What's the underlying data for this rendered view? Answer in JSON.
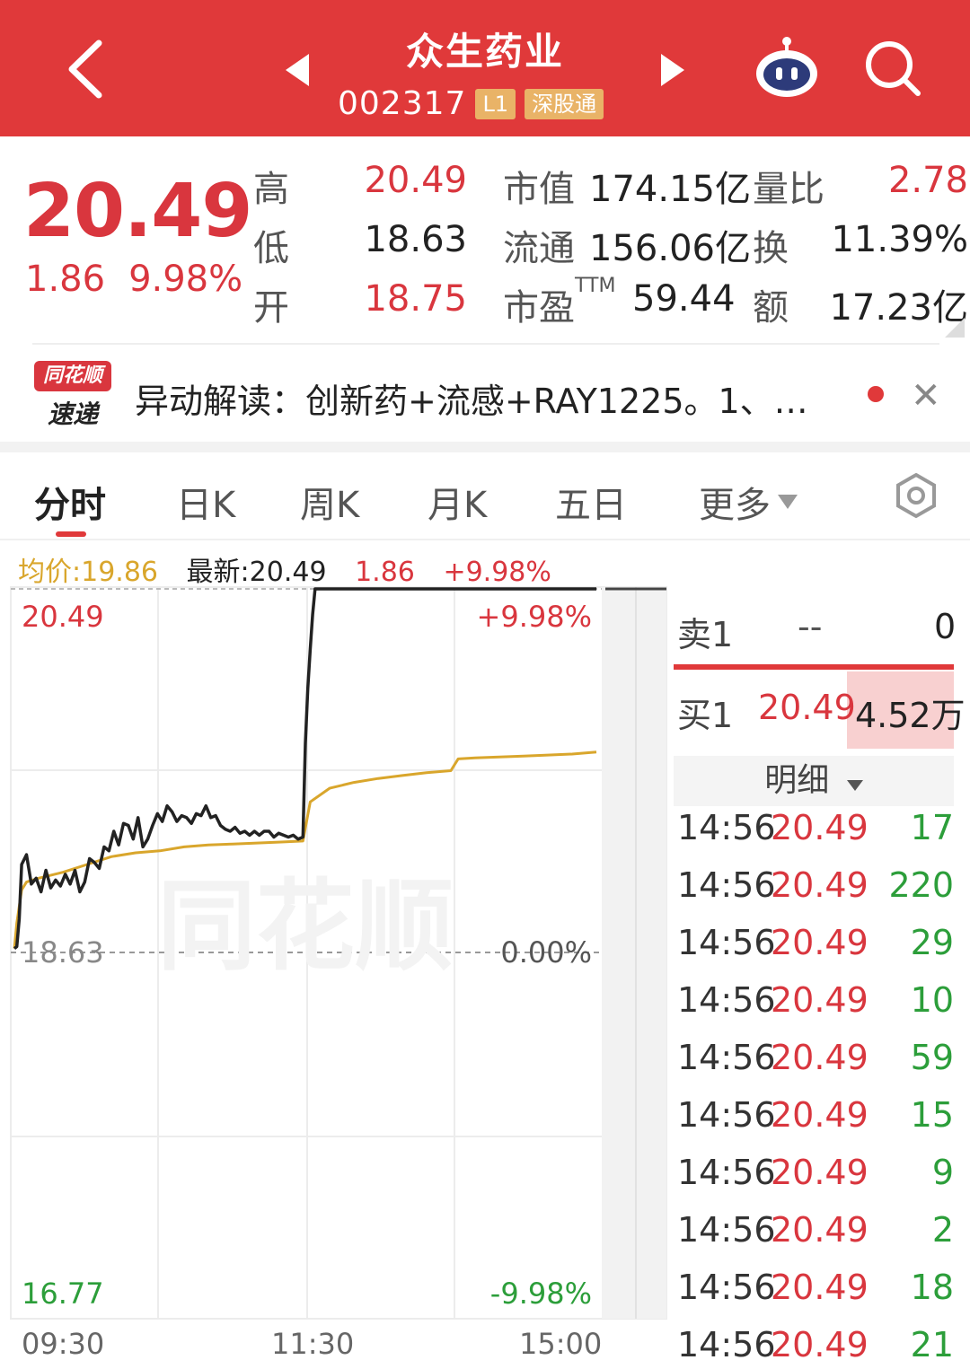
{
  "header": {
    "title": "众生药业",
    "code": "002317",
    "badge_level": "L1",
    "badge_connect": "深股通"
  },
  "quote": {
    "price": "20.49",
    "change": "1.86",
    "change_pct": "9.98%",
    "high_label": "高",
    "high": "20.49",
    "low_label": "低",
    "low": "18.63",
    "open_label": "开",
    "open": "18.75",
    "mcap_label": "市值",
    "mcap": "174.15亿",
    "float_label": "流通",
    "float": "156.06亿",
    "pe_label": "市盈",
    "pe_sup": "TTM",
    "pe": "59.44",
    "vol_ratio_label": "量比",
    "vol_ratio": "2.78",
    "turnover_label": "换",
    "turnover": "11.39%",
    "amount_label": "额",
    "amount": "17.23亿"
  },
  "news": {
    "logo_top": "同花顺",
    "logo_bottom": "速递",
    "text": "异动解读：创新药+流感+RAY1225。1、…"
  },
  "tabs": [
    {
      "label": "分时"
    },
    {
      "label": "日K"
    },
    {
      "label": "周K"
    },
    {
      "label": "月K"
    },
    {
      "label": "五日"
    },
    {
      "label": "更多"
    }
  ],
  "legend": {
    "avg": "均价:19.86",
    "latest": "最新:20.49",
    "chg": "1.86",
    "chg_pct": "+9.98%"
  },
  "chart_labels": {
    "top_price": "20.49",
    "top_pct": "+9.98%",
    "mid_price": "18.63",
    "mid_pct": "0.00%",
    "bottom_price": "16.77",
    "bottom_pct": "-9.98%",
    "watermark": "同花顺",
    "time_start": "09:30",
    "time_mid": "11:30",
    "time_end": "15:00"
  },
  "chart_data": {
    "type": "line",
    "ylim": [
      16.77,
      20.49
    ],
    "prev_close": 18.63,
    "x_labels": [
      "09:30",
      "11:30",
      "15:00"
    ],
    "series": [
      {
        "name": "最新",
        "color": "#222222",
        "x": [
          0,
          1,
          2,
          3,
          5,
          7,
          9,
          11,
          13,
          15,
          17,
          19,
          21,
          23,
          25,
          27,
          29,
          31,
          33,
          35,
          37,
          39,
          41,
          43,
          45,
          47,
          49,
          51,
          53,
          55,
          57,
          59,
          61,
          63,
          65,
          67,
          69,
          71,
          73,
          75,
          77,
          79,
          81,
          83,
          85,
          87,
          89,
          91,
          93,
          95,
          97,
          99,
          101,
          103,
          105,
          107,
          109,
          111,
          113,
          115,
          117,
          119,
          120,
          121,
          122,
          123,
          124,
          126,
          130,
          140,
          160,
          180,
          200,
          220,
          240
        ],
        "values": [
          18.65,
          18.66,
          18.8,
          19.08,
          19.13,
          18.98,
          19.01,
          18.94,
          19.05,
          18.96,
          19.0,
          18.97,
          19.03,
          18.98,
          19.05,
          18.94,
          18.99,
          19.11,
          19.09,
          19.06,
          19.17,
          19.15,
          19.25,
          19.18,
          19.29,
          19.28,
          19.21,
          19.32,
          19.17,
          19.21,
          19.28,
          19.34,
          19.3,
          19.38,
          19.35,
          19.3,
          19.33,
          19.32,
          19.29,
          19.34,
          19.33,
          19.38,
          19.32,
          19.33,
          19.28,
          19.26,
          19.25,
          19.27,
          19.24,
          19.25,
          19.23,
          19.25,
          19.23,
          19.25,
          19.25,
          19.22,
          19.24,
          19.23,
          19.22,
          19.23,
          19.21,
          19.22,
          19.7,
          19.98,
          20.18,
          20.36,
          20.49,
          20.49,
          20.49,
          20.49,
          20.49,
          20.49,
          20.49,
          20.49,
          20.49
        ]
      },
      {
        "name": "均价",
        "color": "#d9a62c",
        "x": [
          0,
          1,
          3,
          5,
          10,
          20,
          30,
          40,
          50,
          60,
          70,
          80,
          90,
          100,
          110,
          119,
          122,
          130,
          140,
          150,
          160,
          170,
          180,
          183,
          190,
          200,
          210,
          220,
          230,
          240
        ],
        "values": [
          18.65,
          18.78,
          18.95,
          18.99,
          19.01,
          19.04,
          19.08,
          19.12,
          19.14,
          19.15,
          19.17,
          19.18,
          19.185,
          19.19,
          19.195,
          19.2,
          19.4,
          19.47,
          19.5,
          19.52,
          19.535,
          19.55,
          19.56,
          19.62,
          19.625,
          19.63,
          19.635,
          19.64,
          19.645,
          19.655
        ]
      }
    ]
  },
  "orderbook": {
    "sell_label": "卖1",
    "sell_price": "--",
    "sell_vol": "0",
    "buy_label": "买1",
    "buy_price": "20.49",
    "buy_vol": "4.52万",
    "detail_label": "明细"
  },
  "ticks": [
    {
      "time": "14:56",
      "price": "20.49",
      "vol": "17"
    },
    {
      "time": "14:56",
      "price": "20.49",
      "vol": "220"
    },
    {
      "time": "14:56",
      "price": "20.49",
      "vol": "29"
    },
    {
      "time": "14:56",
      "price": "20.49",
      "vol": "10"
    },
    {
      "time": "14:56",
      "price": "20.49",
      "vol": "59"
    },
    {
      "time": "14:56",
      "price": "20.49",
      "vol": "15"
    },
    {
      "time": "14:56",
      "price": "20.49",
      "vol": "9"
    },
    {
      "time": "14:56",
      "price": "20.49",
      "vol": "2"
    },
    {
      "time": "14:56",
      "price": "20.49",
      "vol": "18"
    },
    {
      "time": "14:56",
      "price": "20.49",
      "vol": "21"
    }
  ],
  "colors": {
    "brand_red": "#e0393a",
    "up_red": "#d9363e",
    "down_green": "#2c9e3a",
    "avg_gold": "#d9a62c"
  }
}
